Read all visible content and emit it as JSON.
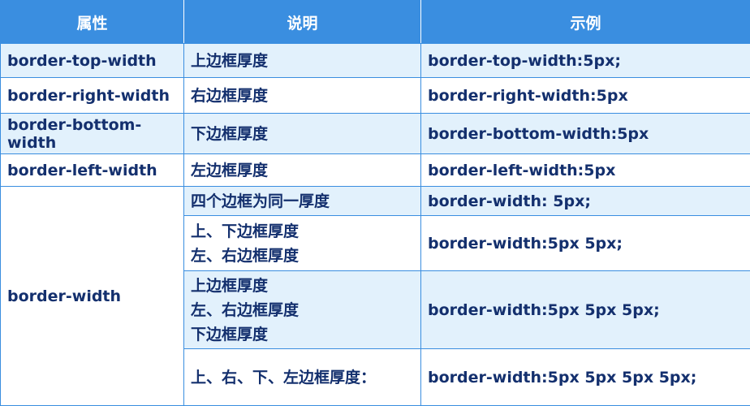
{
  "headers": [
    "属性",
    "说明",
    "示例"
  ],
  "rows": [
    {
      "property": "border-top-width",
      "desc": [
        "上边框厚度"
      ],
      "example": "border-top-width:5px;"
    },
    {
      "property": "border-right-width",
      "desc": [
        "右边框厚度"
      ],
      "example": "border-right-width:5px"
    },
    {
      "property": "border-bottom-width",
      "desc": [
        "下边框厚度"
      ],
      "example": "border-bottom-width:5px"
    },
    {
      "property": "border-left-width",
      "desc": [
        "左边框厚度"
      ],
      "example": "border-left-width:5px"
    }
  ],
  "group": {
    "property": "border-width",
    "rows": [
      {
        "desc": [
          "四个边框为同一厚度"
        ],
        "example": "border-width: 5px;"
      },
      {
        "desc": [
          "上、下边框厚度",
          "左、右边框厚度"
        ],
        "example": "border-width:5px 5px;"
      },
      {
        "desc": [
          "上边框厚度",
          "左、右边框厚度",
          "下边框厚度"
        ],
        "example": "border-width:5px 5px 5px;"
      },
      {
        "desc": [
          "上、右、下、左边框厚度："
        ],
        "example": "border-width:5px 5px 5px 5px;"
      }
    ]
  }
}
